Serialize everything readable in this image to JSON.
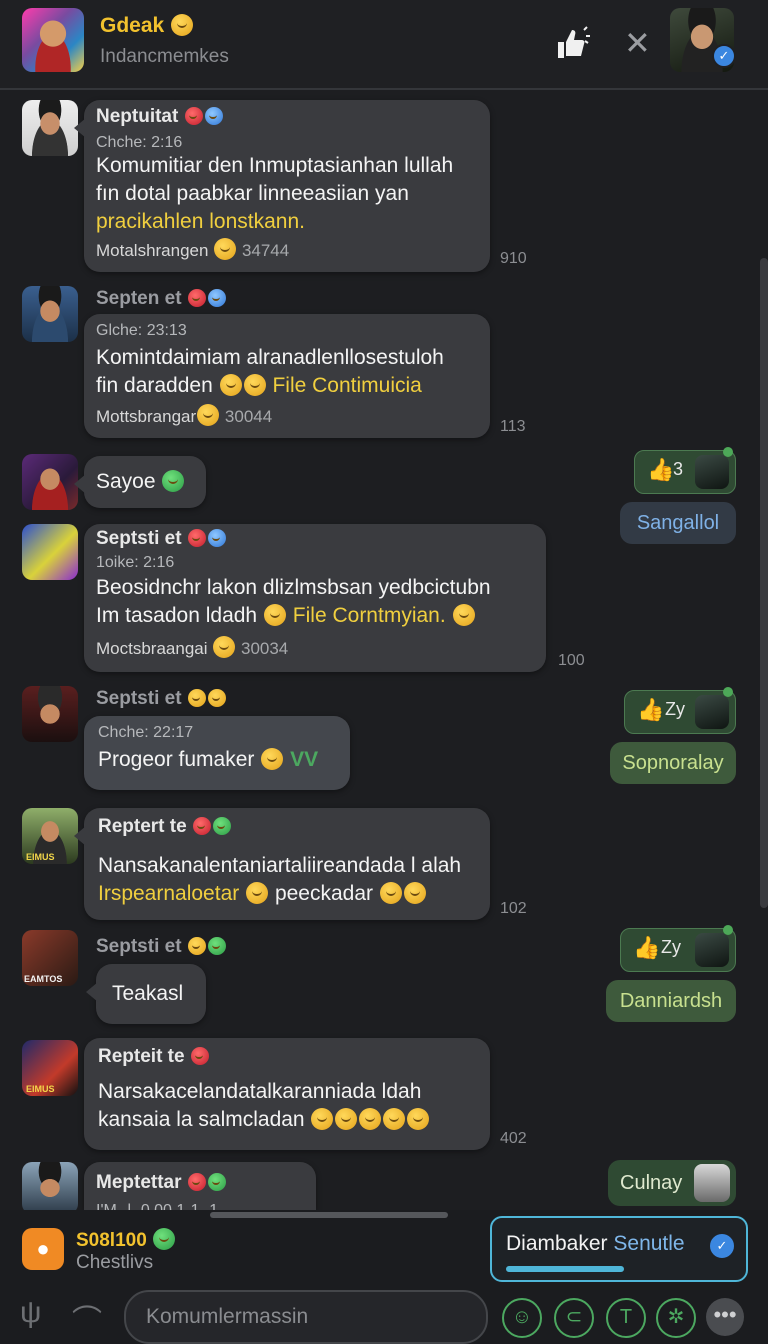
{
  "header": {
    "title": "Gdeak",
    "subtitle": "Indancmemkes"
  },
  "messages": [
    {
      "sender": "Neptuitat",
      "meta": "Chche: 2:16",
      "lines": [
        "Komumitiar den Inmuptasianhan lullah",
        "fın dotal paabkar linneeasiian yan"
      ],
      "highlight": "pracikahlen lonstkann.",
      "footer": "Motalshrangen",
      "footer_num": "34744",
      "count": "910"
    },
    {
      "sender": "Septen et",
      "meta": "Glche: 23:13",
      "lines": [
        "Komintdaimiam alranadlenllosestuloh"
      ],
      "line2_prefix": "fin daradden",
      "highlight": "File Contimuicia",
      "footer": "Mottsbrangar",
      "footer_num": "30044",
      "count": "113"
    },
    {
      "text": "Sayoe"
    },
    {
      "sender": "Septsti et",
      "meta": "1oike: 2:16",
      "lines": [
        "Beosidnchr lakon dlizlmsbsan yedbcictubn"
      ],
      "line2_prefix": "Im tasadon ldadh",
      "highlight": "File Corntmyian.",
      "footer": "Moctsbraangai",
      "footer_num": "30034",
      "count": "100"
    },
    {
      "sender": "Septsti et",
      "meta": "Chche: 22:17",
      "text": "Progeor fumaker",
      "suffix": "VV"
    },
    {
      "sender": "Reptert te",
      "lines": [
        "Nansakanalentaniartaliireandada l alah"
      ],
      "highlight": "Irspearnaloetar",
      "line2_suffix": "peeckadar",
      "count": "102"
    },
    {
      "sender": "Septsti et",
      "text": "Teakasl"
    },
    {
      "sender": "Repteit te",
      "lines": [
        "Narsakacelandatalkaranniada ldah"
      ],
      "line2_prefix": "kansaia la salmcladan",
      "count": "402"
    },
    {
      "sender": "Meptettar",
      "partial": "I'M--l- 0.00 1-1 -1"
    }
  ],
  "right": {
    "react1": "3",
    "pill1": "Sangallol",
    "react2": "Zy",
    "pill2": "Sopnoralay",
    "react3": "Zy",
    "pill3": "Danniardsh",
    "pill4": "Culnay"
  },
  "avatar_labels": {
    "a6": "EIMUS",
    "a7": "EAMTOS",
    "a8": "EIMUS"
  },
  "bottom": {
    "contact_name": "S08l100",
    "contact_sub": "Chestlivs",
    "toast_text": "Diambaker",
    "toast_accent": "Senutle",
    "input_placeholder": "Komumlermassin"
  },
  "colors": {
    "accent_yellow": "#f2c22e",
    "accent_green": "#4ca860",
    "accent_blue": "#4fb6d8"
  }
}
